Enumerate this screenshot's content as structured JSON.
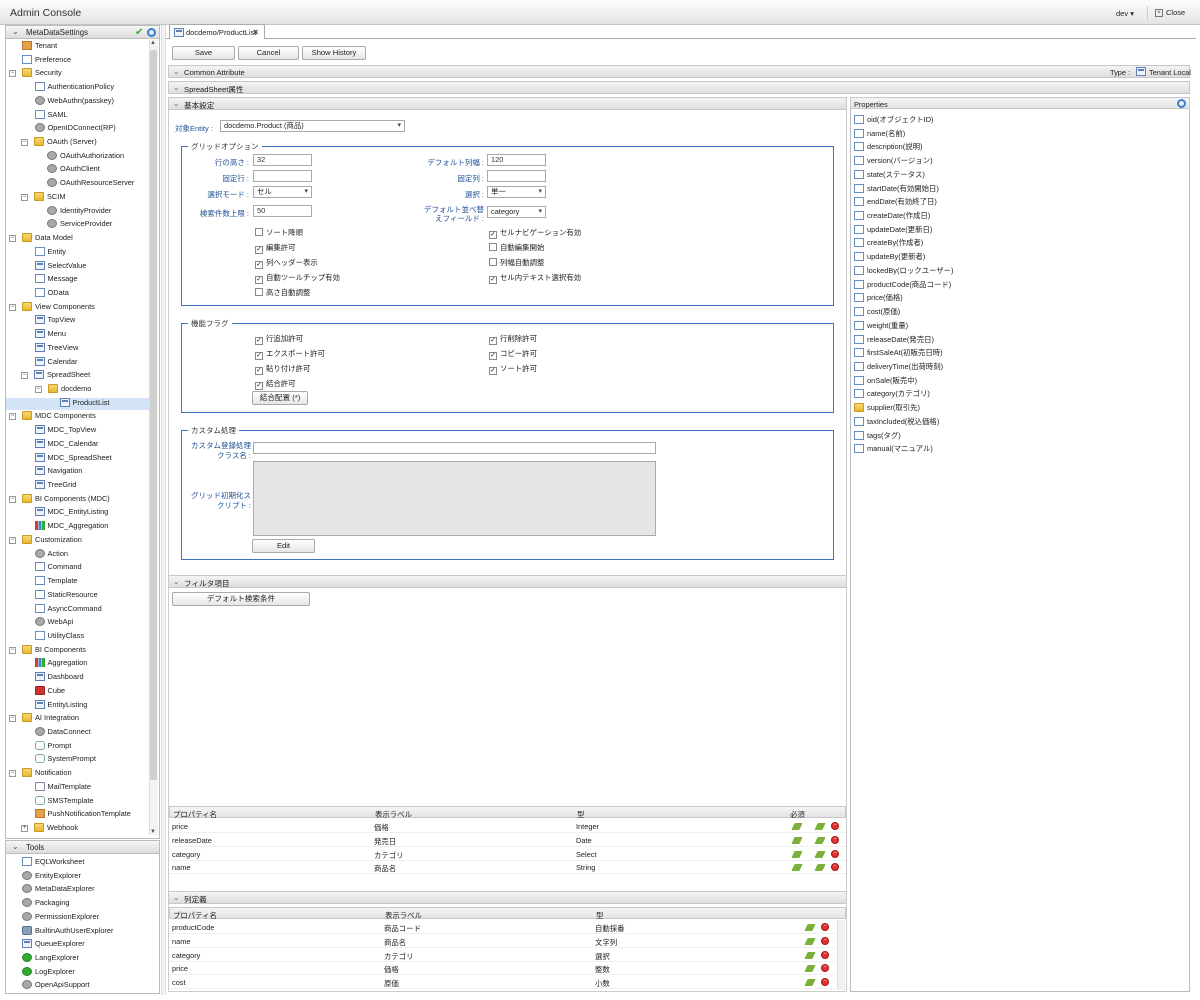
{
  "app_title": "Admin Console",
  "env_label": "dev",
  "close_label": "Close",
  "tree_header": "MetaDataSettings",
  "tree": [
    {
      "label": "Tenant",
      "indent": 0,
      "icon": "house-icon",
      "cls": "i-house"
    },
    {
      "label": "Preference",
      "indent": 0,
      "icon": "document-icon",
      "cls": "i-doc"
    },
    {
      "label": "Security",
      "indent": -1,
      "icon": "folder-icon",
      "cls": "i-folder",
      "toggle": "−"
    },
    {
      "label": "AuthenticationPolicy",
      "indent": 1,
      "icon": "document-icon",
      "cls": "i-doc"
    },
    {
      "label": "WebAuthn(passkey)",
      "indent": 1,
      "icon": "key-icon",
      "cls": "i-gear"
    },
    {
      "label": "SAML",
      "indent": 1,
      "icon": "document-icon",
      "cls": "i-doc"
    },
    {
      "label": "OpenIDConnect(RP)",
      "indent": 1,
      "icon": "openid-icon",
      "cls": "i-gear"
    },
    {
      "label": "OAuth (Server)",
      "indent": 0.5,
      "icon": "folder-icon",
      "cls": "i-folder",
      "toggle": "−"
    },
    {
      "label": "OAuthAuthorization",
      "indent": 2,
      "icon": "gear-icon",
      "cls": "i-gear"
    },
    {
      "label": "OAuthClient",
      "indent": 2,
      "icon": "gear-icon",
      "cls": "i-gear"
    },
    {
      "label": "OAuthResourceServer",
      "indent": 2,
      "icon": "gear-icon",
      "cls": "i-gear"
    },
    {
      "label": "SCIM",
      "indent": 0.5,
      "icon": "folder-icon",
      "cls": "i-folder",
      "toggle": "−"
    },
    {
      "label": "IdentityProvider",
      "indent": 2,
      "icon": "gear-icon",
      "cls": "i-gear"
    },
    {
      "label": "ServiceProvider",
      "indent": 2,
      "icon": "gear-icon",
      "cls": "i-gear"
    },
    {
      "label": "Data Model",
      "indent": -1,
      "icon": "folder-icon",
      "cls": "i-folder",
      "toggle": "−"
    },
    {
      "label": "Entity",
      "indent": 1,
      "icon": "document-icon",
      "cls": "i-doc"
    },
    {
      "label": "SelectValue",
      "indent": 1,
      "icon": "list-icon",
      "cls": "i-page"
    },
    {
      "label": "Message",
      "indent": 1,
      "icon": "document-icon",
      "cls": "i-doc"
    },
    {
      "label": "OData",
      "indent": 1,
      "icon": "document-icon",
      "cls": "i-doc"
    },
    {
      "label": "View Components",
      "indent": -1,
      "icon": "folder-icon",
      "cls": "i-folder",
      "toggle": "−"
    },
    {
      "label": "TopView",
      "indent": 1,
      "icon": "page-icon",
      "cls": "i-page"
    },
    {
      "label": "Menu",
      "indent": 1,
      "icon": "page-icon",
      "cls": "i-page"
    },
    {
      "label": "TreeView",
      "indent": 1,
      "icon": "page-icon",
      "cls": "i-page"
    },
    {
      "label": "Calendar",
      "indent": 1,
      "icon": "page-icon",
      "cls": "i-page"
    },
    {
      "label": "SpreadSheet",
      "indent": 0.5,
      "icon": "page-icon",
      "cls": "i-page",
      "toggle": "−"
    },
    {
      "label": "docdemo",
      "indent": 1.5,
      "icon": "folder-icon",
      "cls": "i-folder",
      "toggle": "−"
    },
    {
      "label": "ProductList",
      "indent": 3,
      "icon": "page-icon",
      "cls": "i-page",
      "selected": true
    },
    {
      "label": "MDC Components",
      "indent": -1,
      "icon": "folder-icon",
      "cls": "i-folder",
      "toggle": "−"
    },
    {
      "label": "MDC_TopView",
      "indent": 1,
      "icon": "page-icon",
      "cls": "i-page"
    },
    {
      "label": "MDC_Calendar",
      "indent": 1,
      "icon": "page-icon",
      "cls": "i-page"
    },
    {
      "label": "MDC_SpreadSheet",
      "indent": 1,
      "icon": "page-icon",
      "cls": "i-page"
    },
    {
      "label": "Navigation",
      "indent": 1,
      "icon": "page-icon",
      "cls": "i-page"
    },
    {
      "label": "TreeGrid",
      "indent": 1,
      "icon": "page-icon",
      "cls": "i-page"
    },
    {
      "label": "BI Components (MDC)",
      "indent": -1,
      "icon": "folder-icon",
      "cls": "i-folder",
      "toggle": "−"
    },
    {
      "label": "MDC_EntityListing",
      "indent": 1,
      "icon": "page-icon",
      "cls": "i-page"
    },
    {
      "label": "MDC_Aggregation",
      "indent": 1,
      "icon": "bar-chart-icon",
      "cls": "i-bar"
    },
    {
      "label": "Customization",
      "indent": -1,
      "icon": "folder-icon",
      "cls": "i-folder",
      "toggle": "−"
    },
    {
      "label": "Action",
      "indent": 1,
      "icon": "action-icon",
      "cls": "i-gear"
    },
    {
      "label": "Command",
      "indent": 1,
      "icon": "document-icon",
      "cls": "i-doc"
    },
    {
      "label": "Template",
      "indent": 1,
      "icon": "document-icon",
      "cls": "i-doc"
    },
    {
      "label": "StaticResource",
      "indent": 1,
      "icon": "document-icon",
      "cls": "i-doc"
    },
    {
      "label": "AsyncCommand",
      "indent": 1,
      "icon": "document-icon",
      "cls": "i-doc"
    },
    {
      "label": "WebApi",
      "indent": 1,
      "icon": "webapi-icon",
      "cls": "i-gear"
    },
    {
      "label": "UtilityClass",
      "indent": 1,
      "icon": "document-icon",
      "cls": "i-doc"
    },
    {
      "label": "BI Components",
      "indent": -1,
      "icon": "folder-icon",
      "cls": "i-folder",
      "toggle": "−"
    },
    {
      "label": "Aggregation",
      "indent": 1,
      "icon": "bar-chart-icon",
      "cls": "i-bar"
    },
    {
      "label": "Dashboard",
      "indent": 1,
      "icon": "page-icon",
      "cls": "i-page"
    },
    {
      "label": "Cube",
      "indent": 1,
      "icon": "cube-icon",
      "cls": "i-red"
    },
    {
      "label": "EntityListing",
      "indent": 1,
      "icon": "page-icon",
      "cls": "i-page"
    },
    {
      "label": "AI Integration",
      "indent": -1,
      "icon": "folder-icon",
      "cls": "i-folder",
      "toggle": "−"
    },
    {
      "label": "DataConnect",
      "indent": 1,
      "icon": "link-icon",
      "cls": "i-gear"
    },
    {
      "label": "Prompt",
      "indent": 1,
      "icon": "chat-icon",
      "cls": "i-chat"
    },
    {
      "label": "SystemPrompt",
      "indent": 1,
      "icon": "chat-icon",
      "cls": "i-chat"
    },
    {
      "label": "Notification",
      "indent": -1,
      "icon": "folder-icon",
      "cls": "i-folder",
      "toggle": "−"
    },
    {
      "label": "MailTemplate",
      "indent": 1,
      "icon": "mail-icon",
      "cls": "i-mail"
    },
    {
      "label": "SMSTemplate",
      "indent": 1,
      "icon": "chat-icon",
      "cls": "i-chat"
    },
    {
      "label": "PushNotificationTemplate",
      "indent": 1,
      "icon": "push-icon",
      "cls": "i-house"
    },
    {
      "label": "Webhook",
      "indent": 0.5,
      "icon": "folder-icon",
      "cls": "i-folder",
      "toggle": "+"
    }
  ],
  "tools_header": "Tools",
  "tools": [
    {
      "label": "EQLWorksheet",
      "icon": "worksheet-icon",
      "cls": "i-doc"
    },
    {
      "label": "EntityExplorer",
      "icon": "explorer-icon",
      "cls": "i-gear"
    },
    {
      "label": "MetaDataExplorer",
      "icon": "gear-icon",
      "cls": "i-gear"
    },
    {
      "label": "Packaging",
      "icon": "package-icon",
      "cls": "i-gear"
    },
    {
      "label": "PermissionExplorer",
      "icon": "permission-icon",
      "cls": "i-gear"
    },
    {
      "label": "BuiltinAuthUserExplorer",
      "icon": "user-icon",
      "cls": "i-lock"
    },
    {
      "label": "QueueExplorer",
      "icon": "queue-icon",
      "cls": "i-page"
    },
    {
      "label": "LangExplorer",
      "icon": "globe-icon",
      "cls": "i-green"
    },
    {
      "label": "LogExplorer",
      "icon": "log-icon",
      "cls": "i-green"
    },
    {
      "label": "OpenApiSupport",
      "icon": "api-icon",
      "cls": "i-gear"
    }
  ],
  "tab_label": "docdemo/ProductList",
  "buttons": {
    "save": "Save",
    "cancel": "Cancel",
    "history": "Show History"
  },
  "sections": {
    "common": "Common Attribute",
    "type_label": "Type :",
    "type_value": "Tenant Local",
    "spreadsheet": "SpreadSheet属性",
    "basic": "基本設定",
    "filter": "フィルタ項目",
    "columns": "列定義",
    "properties": "Properties"
  },
  "basic": {
    "entity_label": "対象Entity :",
    "entity_value": "docdemo.Product (商品)",
    "grid_legend": "グリッドオプション",
    "row_height_label": "行の高さ :",
    "row_height": "32",
    "fixed_rows_label": "固定行 :",
    "fixed_rows": "",
    "select_mode_label": "選択モード :",
    "select_mode": "セル",
    "search_limit_label": "検索件数上限 :",
    "search_limit": "50",
    "default_col_width_label": "デフォルト列幅 :",
    "default_col_width": "120",
    "fixed_cols_label": "固定列 :",
    "fixed_cols": "",
    "selection_label": "選択 :",
    "selection": "単一",
    "default_sort_label1": "デフォルト並べ替",
    "default_sort_label2": "えフィールド :",
    "default_sort": "category",
    "checks_left": [
      {
        "label": "ソート降順",
        "checked": false
      },
      {
        "label": "編集許可",
        "checked": true
      },
      {
        "label": "列ヘッダー表示",
        "checked": true
      },
      {
        "label": "自動ツールチップ有効",
        "checked": true
      },
      {
        "label": "高さ自動調整",
        "checked": false
      }
    ],
    "checks_right": [
      {
        "label": "セルナビゲーション有効",
        "checked": true
      },
      {
        "label": "自動編集開始",
        "checked": false
      },
      {
        "label": "列幅自動調整",
        "checked": false
      },
      {
        "label": "セル内テキスト選択有効",
        "checked": true
      }
    ],
    "func_legend": "機能フラグ",
    "func_left": [
      {
        "label": "行追加許可",
        "checked": true
      },
      {
        "label": "エクスポート許可",
        "checked": true
      },
      {
        "label": "貼り付け許可",
        "checked": true
      },
      {
        "label": "結合許可",
        "checked": true
      }
    ],
    "func_right": [
      {
        "label": "行削除許可",
        "checked": true
      },
      {
        "label": "コピー許可",
        "checked": true
      },
      {
        "label": "ソート許可",
        "checked": true
      }
    ],
    "merge_button": "結合配置 (*)",
    "custom_legend": "カスタム処理",
    "custom_class_label1": "カスタム登録処理",
    "custom_class_label2": "クラス名 :",
    "custom_class": "",
    "init_script_label1": "グリッド初期化ス",
    "init_script_label2": "クリプト :",
    "edit_button": "Edit"
  },
  "filter": {
    "default_button": "デフォルト検索条件",
    "headers": [
      "プロパティ名",
      "表示ラベル",
      "型",
      "必須"
    ],
    "rows": [
      [
        "price",
        "価格",
        "Integer"
      ],
      [
        "releaseDate",
        "発売日",
        "Date"
      ],
      [
        "category",
        "カテゴリ",
        "Select"
      ],
      [
        "name",
        "商品名",
        "String"
      ]
    ]
  },
  "columns": {
    "headers": [
      "プロパティ名",
      "表示ラベル",
      "型"
    ],
    "rows": [
      [
        "productCode",
        "商品コード",
        "自動採番"
      ],
      [
        "name",
        "商品名",
        "文字列"
      ],
      [
        "category",
        "カテゴリ",
        "選択"
      ],
      [
        "price",
        "価格",
        "整数"
      ],
      [
        "cost",
        "原価",
        "小数"
      ]
    ]
  },
  "properties": [
    "oid(オブジェクトID)",
    "name(名前)",
    "description(説明)",
    "version(バージョン)",
    "state(ステータス)",
    "startDate(有効開始日)",
    "endDate(有効終了日)",
    "createDate(作成日)",
    "updateDate(更新日)",
    "createBy(作成者)",
    "updateBy(更新者)",
    "lockedBy(ロックユーザー)",
    "productCode(商品コード)",
    "price(価格)",
    "cost(原価)",
    "weight(重量)",
    "releaseDate(発売日)",
    "firstSaleAt(初販売日時)",
    "deliveryTime(出荷時刻)",
    "onSale(販売中)",
    "category(カテゴリ)",
    "supplier(取引先)",
    "taxIncluded(税込価格)",
    "tags(タグ)",
    "manual(マニュアル)"
  ],
  "properties_folder_index": 21
}
